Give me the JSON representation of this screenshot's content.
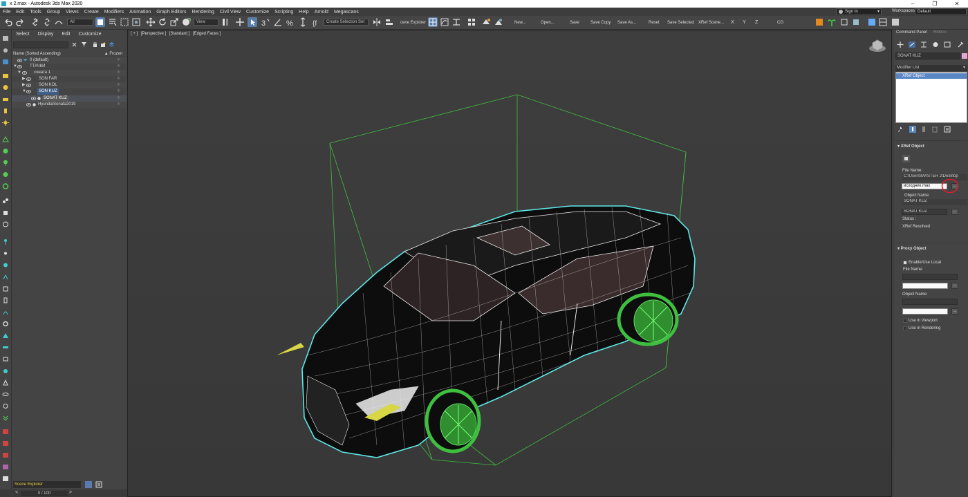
{
  "window": {
    "title": "x 2.max - Autodesk 3ds Max 2020",
    "controls": [
      "–",
      "❐",
      "✕"
    ]
  },
  "menu": [
    "File",
    "Edit",
    "Tools",
    "Group",
    "Views",
    "Create",
    "Modifiers",
    "Animation",
    "Graph Editors",
    "Rendering",
    "Civil View",
    "Customize",
    "Scripting",
    "Help",
    "Arnold",
    "Megascans"
  ],
  "account": {
    "sign_in": "Sign In",
    "workspaces_label": "Workspaces:",
    "workspace_value": "Default"
  },
  "toolbar": {
    "filter_value": "All",
    "refcoord_value": "View",
    "selection_set_placeholder": "Create Selection Set",
    "scene_explorer_label": "cene Explorer",
    "buttons": {
      "new": "New...",
      "open": "Open...",
      "save": "Save",
      "save_copy": "Save Copy",
      "save_as": "Save As...",
      "reset": "Reset",
      "save_selected": "Save Selected",
      "xref_scene": "XRef Scene...",
      "x": "X",
      "y": "Y",
      "z": "Z",
      "cg": "CG"
    }
  },
  "scene_explorer": {
    "menu": [
      "Select",
      "Display",
      "Edit",
      "Customize"
    ],
    "header_name": "Name (Sorted Ascending)",
    "header_frozen": "▲ Frozen",
    "rows": [
      {
        "label": "0 (default)"
      },
      {
        "label": "ТТАЧКИ"
      },
      {
        "label": "соната 1"
      },
      {
        "label": "SON FAR"
      },
      {
        "label": "SON KOL"
      },
      {
        "label": "SON KUZ"
      },
      {
        "label": "SONAT KUZ"
      },
      {
        "label": "HyundaiSonata2019"
      }
    ],
    "tab_label": "Scene Explorer"
  },
  "status": {
    "progress": "0 / 100",
    "arrow_left": "<",
    "arrow_right": ">"
  },
  "viewport": {
    "labels": [
      "[ + ]",
      "[Perspective ]",
      "[Standard ]",
      "[Edged Faces ]"
    ]
  },
  "command_panel": {
    "tabs": [
      "Command Panel",
      "Ribbon"
    ],
    "object_name": "SONAT KUZ",
    "object_color": "#e6a6d6",
    "modifier_list": "Modifier List",
    "stack_item": "XRef Object",
    "xref_rollout": {
      "title": "XRef Object",
      "file_name_label": "File Name:",
      "file_path": "C:\\Users\\MASTER 2\\Desktop",
      "file_field": "исходник.max",
      "browse": "...",
      "object_name_label": "Object Name:",
      "object_name_value": "SONAT KUZ",
      "object_field": "SONAT KUZ",
      "status_label": "Status :",
      "status_value": "XRef Resolved"
    },
    "proxy_rollout": {
      "title": "Proxy Object",
      "enable_use_local": "Enable/Use Local",
      "file_name_label": "File Name:",
      "object_name_label": "Object Name:",
      "use_in_viewport": "Use in Viewport",
      "use_in_rendering": "Use in Rendering",
      "browse": "..."
    }
  },
  "colors": {
    "accent_selected": "#3f5f86",
    "wire_green": "#3fbf3f",
    "highlight_cyan": "#5fe6e6",
    "annotation_red": "#e0202a"
  }
}
